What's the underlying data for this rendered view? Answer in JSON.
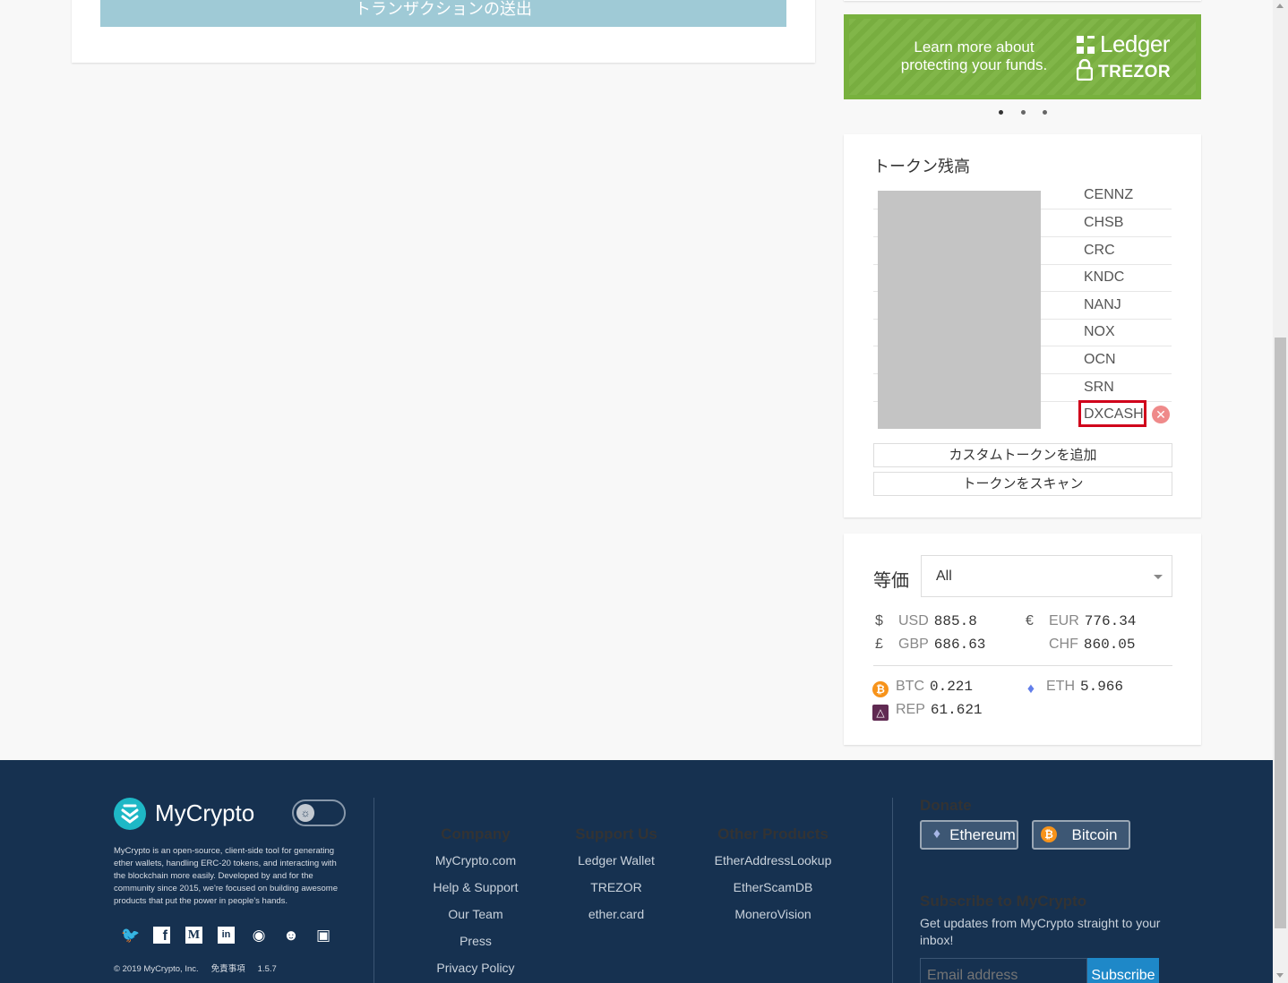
{
  "send": {
    "label": "トランザクションの送出"
  },
  "banner": {
    "line1": "Learn more about",
    "line2": "protecting your funds.",
    "ledger": "Ledger",
    "trezor": "TREZOR",
    "slides": 3,
    "active_slide": 0
  },
  "tokens": {
    "title": "トークン残高",
    "items": [
      "CENNZ",
      "CHSB",
      "CRC",
      "KNDC",
      "NANJ",
      "NOX",
      "OCN",
      "SRN",
      "DXCASH"
    ],
    "highlighted": "DXCASH",
    "add_custom": "カスタムトークンを追加",
    "scan": "トークンをスキャン",
    "remove_glyph": "✕"
  },
  "equiv": {
    "title": "等価",
    "selected": "All",
    "fiat": [
      {
        "symbol": "$",
        "code": "USD",
        "value": "885.8"
      },
      {
        "symbol": "€",
        "code": "EUR",
        "value": "776.34"
      },
      {
        "symbol": "£",
        "code": "GBP",
        "value": "686.63"
      },
      {
        "symbol": "",
        "code": "CHF",
        "value": "860.05"
      }
    ],
    "crypto": [
      {
        "code": "BTC",
        "value": "0.221",
        "color": "#f7931a",
        "icon": "bitcoin-icon"
      },
      {
        "code": "ETH",
        "value": "5.966",
        "color": "#627eea",
        "icon": "ethereum-icon"
      },
      {
        "code": "REP",
        "value": "61.621",
        "color": "#602a52",
        "icon": "augur-icon"
      }
    ]
  },
  "footer": {
    "brand": "MyCrypto",
    "about": "MyCrypto is an open-source, client-side tool for generating ether wallets, handling ERC-20 tokens, and interacting with the blockchain more easily. Developed by and for the community since 2015, we're focused on building awesome products that put the power in people's hands.",
    "copyright": "© 2019 MyCrypto, Inc.",
    "disclaimer": "免責事項",
    "version": "1.5.7",
    "company": {
      "title": "Company",
      "links": [
        "MyCrypto.com",
        "Help & Support",
        "Our Team",
        "Press",
        "Privacy Policy"
      ]
    },
    "support": {
      "title": "Support Us",
      "links": [
        "Ledger Wallet",
        "TREZOR",
        "ether.card"
      ]
    },
    "products": {
      "title": "Other Products",
      "links": [
        "EtherAddressLookup",
        "EtherScamDB",
        "MoneroVision"
      ]
    },
    "donate": {
      "title": "Donate",
      "ethereum": "Ethereum",
      "bitcoin": "Bitcoin"
    },
    "subscribe": {
      "title": "Subscribe to MyCrypto",
      "text": "Get updates from MyCrypto straight to your inbox!",
      "placeholder": "Email address",
      "button": "Subscribe"
    },
    "social_glyphs": {
      "twitter": "🐦",
      "facebook": "f",
      "medium": "M",
      "linkedin": "in",
      "github": "◉",
      "reddit": "☻",
      "discord": "▣"
    }
  },
  "colors": {
    "accent": "#1eb8c6",
    "footer_bg": "#163150",
    "highlight": "#d0021b"
  }
}
